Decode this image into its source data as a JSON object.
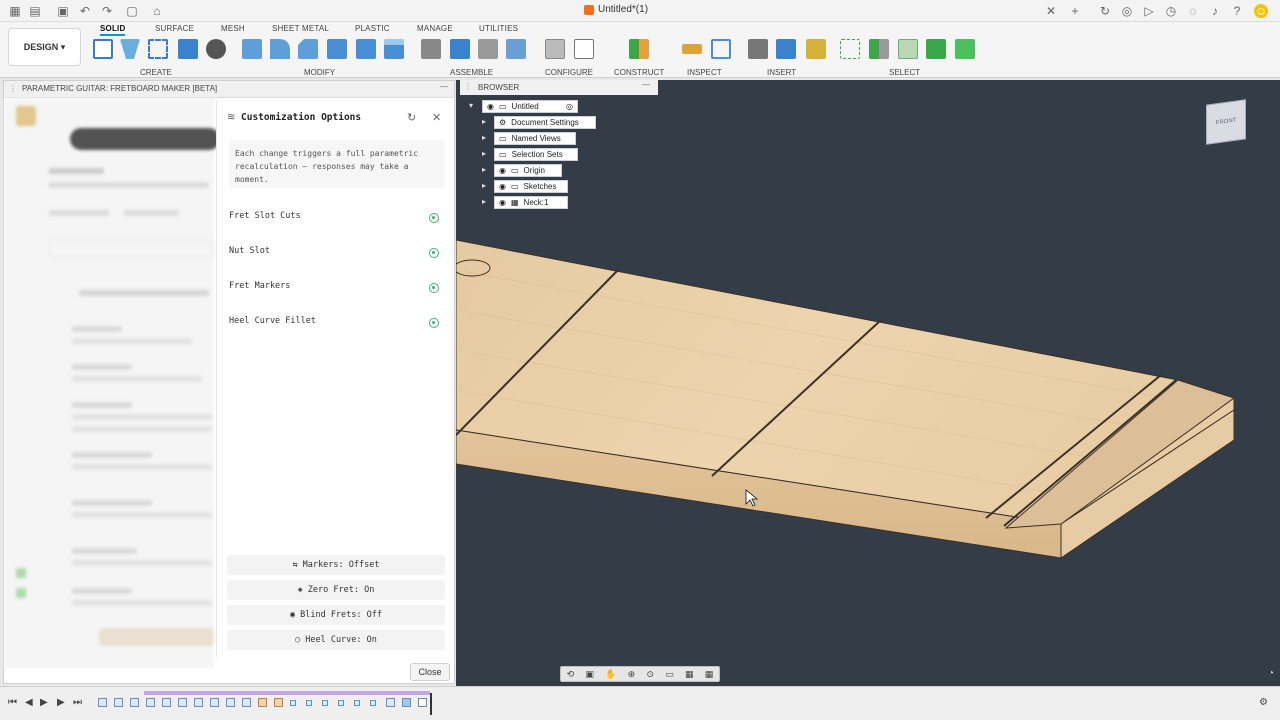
{
  "app": {
    "document_title": "Untitled*(1)"
  },
  "ribbon": {
    "workspace": "DESIGN",
    "tabs": [
      "SOLID",
      "SURFACE",
      "MESH",
      "SHEET METAL",
      "PLASTIC",
      "MANAGE",
      "UTILITIES"
    ],
    "active_tab": "SOLID",
    "groups": {
      "create": "CREATE",
      "modify": "MODIFY",
      "assemble": "ASSEMBLE",
      "configure": "CONFIGURE",
      "construct": "CONSTRUCT",
      "inspect": "INSPECT",
      "insert": "INSERT",
      "select": "SELECT"
    }
  },
  "left_panel": {
    "title": "PARAMETRIC GUITAR: FRETBOARD MAKER [BETA]"
  },
  "card": {
    "title": "Customization Options",
    "note": "Each change triggers a full parametric recalculation — responses may take a moment.",
    "options": [
      {
        "label": "Fret Slot Cuts"
      },
      {
        "label": "Nut Slot"
      },
      {
        "label": "Fret Markers"
      },
      {
        "label": "Heel Curve Fillet"
      }
    ],
    "actions": [
      {
        "label": "Markers: Offset"
      },
      {
        "label": "Zero Fret: On"
      },
      {
        "label": "Blind Frets: Off"
      },
      {
        "label": "Heel Curve: On"
      }
    ],
    "close_label": "Close"
  },
  "browser": {
    "title": "BROWSER",
    "root": "Untitled",
    "items": [
      {
        "label": "Document Settings"
      },
      {
        "label": "Named Views"
      },
      {
        "label": "Selection Sets"
      },
      {
        "label": "Origin"
      },
      {
        "label": "Sketches"
      },
      {
        "label": "Neck:1"
      }
    ]
  },
  "viewcube": {
    "face": "FRONT"
  },
  "colors": {
    "viewport_bg": "#343c47",
    "wood": "#e9cfa6",
    "accent": "#0696d7",
    "toggle_on": "#3cb371"
  }
}
